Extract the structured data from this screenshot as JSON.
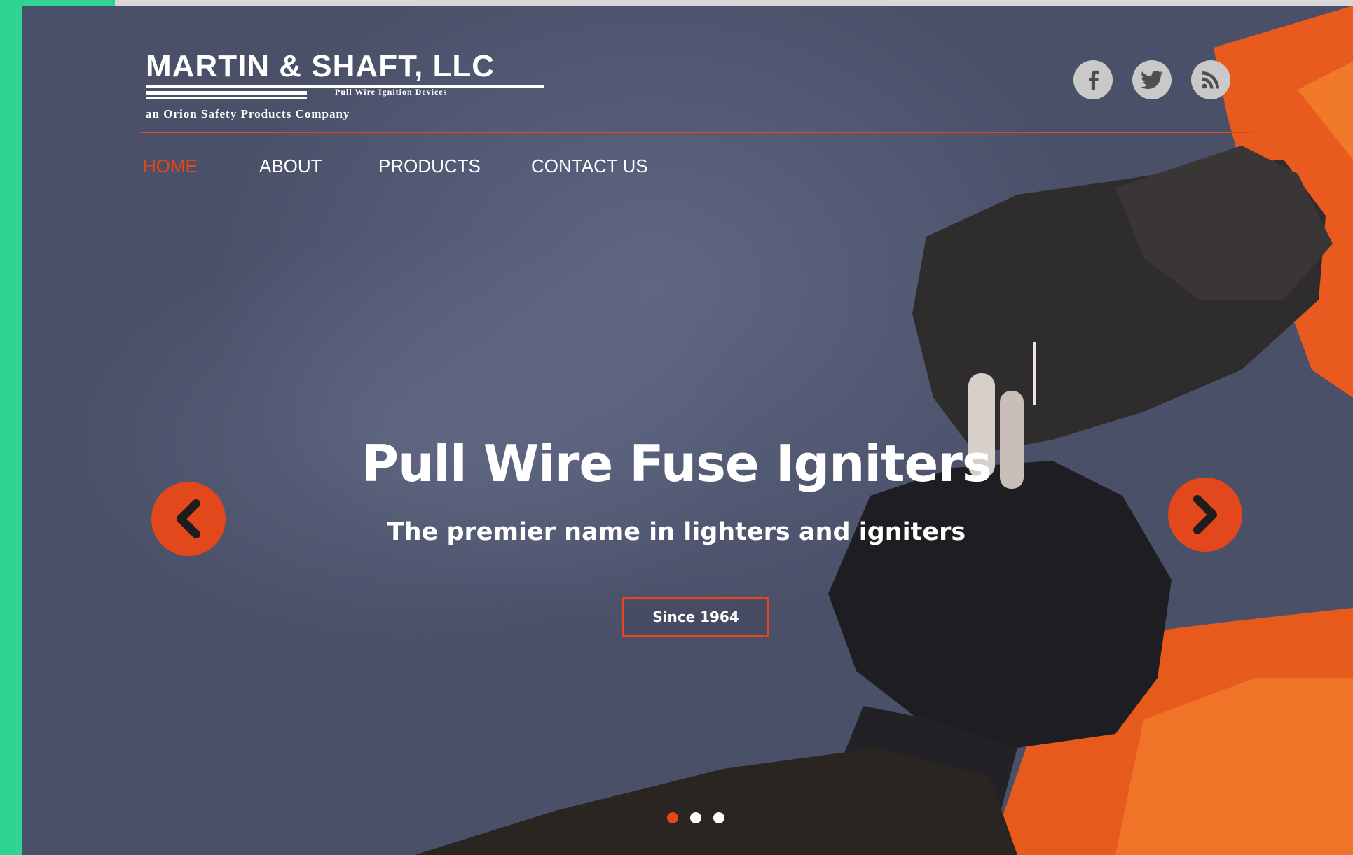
{
  "brand": {
    "title": "MARTIN & SHAFT, LLC",
    "tagline": "Pull Wire Ignition Devices",
    "subtitle": "an Orion Safety Products Company"
  },
  "social": [
    {
      "name": "facebook-icon"
    },
    {
      "name": "twitter-icon"
    },
    {
      "name": "rss-icon"
    }
  ],
  "nav": {
    "items": [
      {
        "label": "HOME",
        "active": true
      },
      {
        "label": "ABOUT",
        "active": false
      },
      {
        "label": "PRODUCTS",
        "active": false
      },
      {
        "label": "CONTACT US",
        "active": false
      }
    ]
  },
  "hero": {
    "headline": "Pull Wire Fuse Igniters",
    "subhead": "The premier name in lighters and igniters",
    "cta_label": "Since 1964",
    "slides_total": 3,
    "active_slide": 1
  },
  "colors": {
    "accent": "#e2481b",
    "page_frame": "#2fd393",
    "hero_bg": "#4a5068"
  }
}
